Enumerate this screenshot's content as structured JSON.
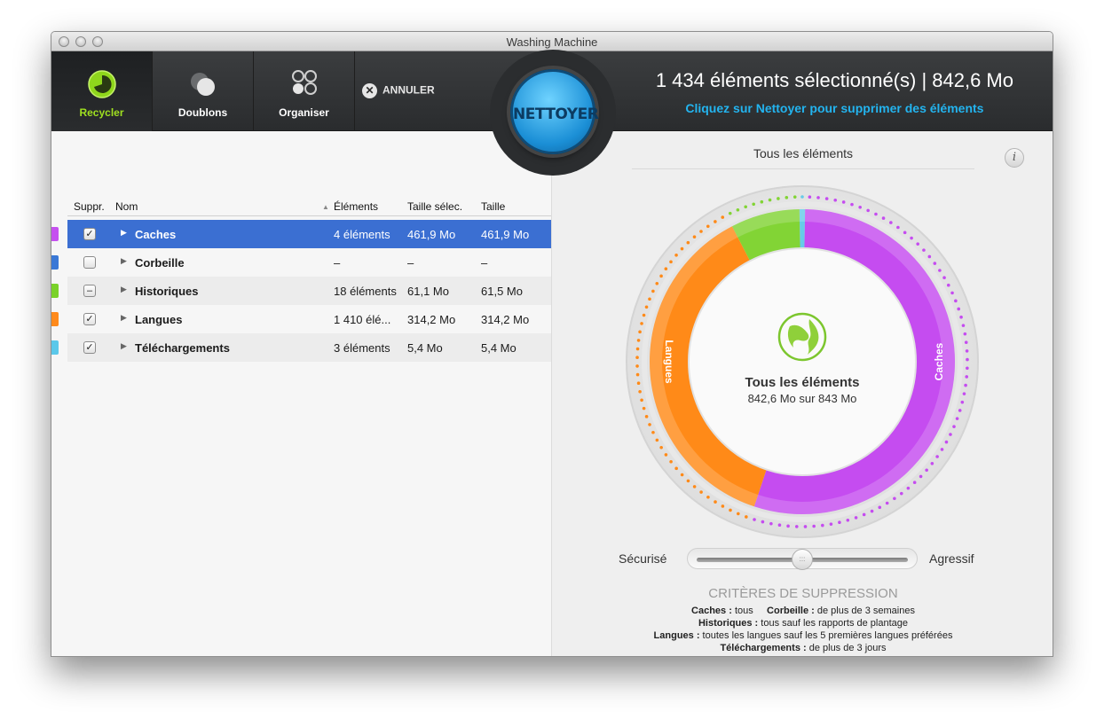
{
  "window": {
    "title": "Washing Machine"
  },
  "toolbar": {
    "tools": [
      {
        "label": "Recycler",
        "icon": "recycler-icon"
      },
      {
        "label": "Doublons",
        "icon": "doublons-icon"
      },
      {
        "label": "Organiser",
        "icon": "organiser-icon"
      }
    ],
    "cancel_label": "ANNULER",
    "clean_button": "NETTOYER",
    "summary_line1": "1 434 éléments sélectionné(s) | 842,6 Mo",
    "summary_line2": "Cliquez sur Nettoyer pour supprimer des éléments"
  },
  "table": {
    "headers": {
      "suppr": "Suppr.",
      "nom": "Nom",
      "elements": "Éléments",
      "taille_sel": "Taille sélec.",
      "taille": "Taille"
    },
    "rows": [
      {
        "name": "Caches",
        "elements": "4 éléments",
        "taille_sel": "461,9 Mo",
        "taille": "461,9 Mo",
        "color": "#c550ef",
        "check": "✓"
      },
      {
        "name": "Corbeille",
        "elements": "–",
        "taille_sel": "–",
        "taille": "–",
        "color": "#3a78d6",
        "check": ""
      },
      {
        "name": "Historiques",
        "elements": "18 éléments",
        "taille_sel": "61,1 Mo",
        "taille": "61,5 Mo",
        "color": "#7ad22a",
        "check": "–"
      },
      {
        "name": "Langues",
        "elements": "1 410 élé...",
        "taille_sel": "314,2 Mo",
        "taille": "314,2 Mo",
        "color": "#ff8a1c",
        "check": "✓"
      },
      {
        "name": "Téléchargements",
        "elements": "3 éléments",
        "taille_sel": "5,4 Mo",
        "taille": "5,4 Mo",
        "color": "#5bc8ea",
        "check": "✓"
      }
    ]
  },
  "panel": {
    "title": "Tous les éléments",
    "center_title": "Tous les éléments",
    "center_sub": "842,6 Mo sur 843 Mo",
    "ring_labels": {
      "langues": "Langues",
      "caches": "Caches"
    },
    "ring_segments": [
      {
        "name": "Caches",
        "fraction": 0.548,
        "color": "#c54cf0"
      },
      {
        "name": "Langues",
        "fraction": 0.373,
        "color": "#ff8a18"
      },
      {
        "name": "Historiques",
        "fraction": 0.073,
        "color": "#82d435"
      },
      {
        "name": "Téléchargements",
        "fraction": 0.006,
        "color": "#66cbe8"
      }
    ],
    "slider": {
      "left_label": "Sécurisé",
      "right_label": "Agressif",
      "value": 0.5
    },
    "criteria_title": "CRITÈRES DE SUPPRESSION",
    "criteria": {
      "caches_k": "Caches :",
      "caches_v": " tous",
      "corbeille_k": "Corbeille :",
      "corbeille_v": " de plus de 3 semaines",
      "historiques_k": "Historiques :",
      "historiques_v": " tous sauf les rapports de plantage",
      "langues_k": "Langues :",
      "langues_v": " toutes les langues sauf les 5 premières langues préférées",
      "telechargements_k": "Téléchargements :",
      "telechargements_v": " de plus de 3 jours"
    }
  }
}
